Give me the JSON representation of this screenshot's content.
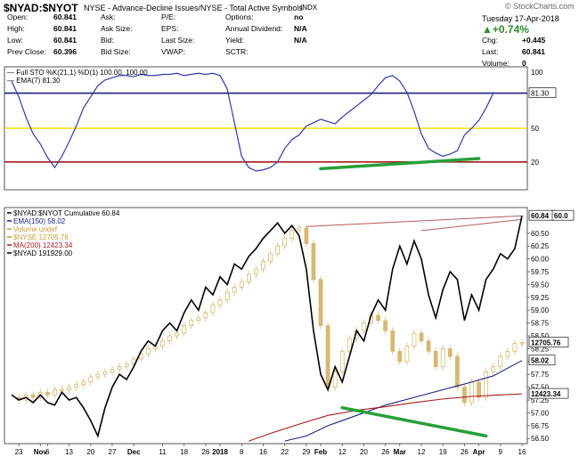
{
  "header": {
    "symbol": "$NYAD:$NYOT",
    "description": "NYSE - Advance-Decline Issues/NYSE - Total Active Symbols",
    "index_tag": "INDX",
    "watermark": "© StockCharts.com",
    "date": "Tuesday  17-Apr-2018",
    "change_pct": "+0.74%",
    "quote": [
      {
        "label": "Open:",
        "value": "60.841"
      },
      {
        "label": "High:",
        "value": "60.841"
      },
      {
        "label": "Low:",
        "value": "60.841"
      },
      {
        "label": "Prev Close:",
        "value": "60.396"
      },
      {
        "label": "Ask:",
        "value": ""
      },
      {
        "label": "Ask Size:",
        "value": ""
      },
      {
        "label": "Bid:",
        "value": ""
      },
      {
        "label": "Bid Size:",
        "value": ""
      },
      {
        "label": "P/E:",
        "value": ""
      },
      {
        "label": "EPS:",
        "value": ""
      },
      {
        "label": "Last Size:",
        "value": ""
      },
      {
        "label": "VWAP:",
        "value": ""
      },
      {
        "label": "Options:",
        "value": "no"
      },
      {
        "label": "Annual Dividend:",
        "value": "N/A"
      },
      {
        "label": "Yield:",
        "value": "N/A"
      },
      {
        "label": "SCTR:",
        "value": ""
      }
    ],
    "right": [
      {
        "label": "Chg:",
        "value": "+0.445"
      },
      {
        "label": "Last:",
        "value": "60.841"
      },
      {
        "label": "Volume:",
        "value": "0"
      }
    ]
  },
  "chart_data": [
    {
      "type": "line",
      "panel": "stochastic",
      "legend": [
        "Full STO %K(21,1) %D(1) 100.00, 100.00",
        "EMA(7) 81.30"
      ],
      "ylim": [
        0,
        100
      ],
      "y_ticks": [
        20,
        50,
        81.3,
        100
      ],
      "reference_lines": [
        {
          "value": 81.3,
          "color": "#1a237e"
        },
        {
          "value": 50,
          "color": "#f2e100"
        },
        {
          "value": 20,
          "color": "#a61b1b"
        }
      ],
      "series": [
        {
          "name": "EMA(7)",
          "color": "#2f3aa8",
          "values": [
            92,
            78,
            60,
            45,
            36,
            24,
            15,
            25,
            38,
            52,
            68,
            78,
            88,
            93,
            95,
            97,
            97,
            96,
            98,
            97,
            97,
            98,
            98,
            99,
            97,
            98,
            99,
            98,
            99,
            97,
            85,
            55,
            25,
            15,
            12,
            13,
            15,
            20,
            32,
            40,
            44,
            52,
            55,
            58,
            56,
            54,
            60,
            65,
            70,
            75,
            80,
            88,
            95,
            97,
            92,
            82,
            65,
            45,
            32,
            28,
            25,
            27,
            30,
            44,
            50,
            57,
            68,
            81.3
          ]
        }
      ],
      "annotation": {
        "type": "trendline",
        "color": "#27a03a",
        "from": [
          43,
          14
        ],
        "to": [
          65,
          23
        ]
      }
    },
    {
      "type": "line",
      "panel": "main",
      "legend": [
        {
          "text": "$NYAD:$NYOT Cumulative 60.84",
          "color": "#000000"
        },
        {
          "text": "EMA(150) 58.02",
          "color": "#1a237e"
        },
        {
          "text": "Volume undef",
          "color": "#c89a3a"
        },
        {
          "text": "$NYSE 12705.76",
          "color": "#c89a3a"
        },
        {
          "text": "MA(200) 12423.34",
          "color": "#a61b1b"
        },
        {
          "text": "$NYAD 191929.00",
          "color": "#000000"
        }
      ],
      "ylim": [
        56.4,
        61.0
      ],
      "y_ticks": [
        56.5,
        56.75,
        57.0,
        57.25,
        57.5,
        57.75,
        58.0,
        58.25,
        58.5,
        58.75,
        59.0,
        59.25,
        59.5,
        59.75,
        60.0,
        60.25,
        60.5
      ],
      "y_tick_labels": [
        "56.50",
        "56.75",
        "57.00",
        "57.25",
        "57.50",
        "57.75",
        "58.00",
        "58.25",
        "58.50",
        "58.75",
        "59.00",
        "59.25",
        "59.50",
        "59.75",
        "60.00",
        "60.25",
        "60.50"
      ],
      "price_tags": [
        {
          "label": "60.84",
          "value": 60.84
        },
        {
          "label": "60.0",
          "value": 60.84
        },
        {
          "label": "12705.76",
          "value": 58.37
        },
        {
          "label": "58.02",
          "value": 58.02
        },
        {
          "label": "12423.34",
          "value": 57.37
        }
      ],
      "x_ticks": [
        {
          "label": "23",
          "i": 1
        },
        {
          "label": "Nov",
          "i": 4,
          "bold": true
        },
        {
          "label": "6",
          "i": 5
        },
        {
          "label": "13",
          "i": 8
        },
        {
          "label": "20",
          "i": 11
        },
        {
          "label": "27",
          "i": 14
        },
        {
          "label": "Dec",
          "i": 17,
          "bold": true
        },
        {
          "label": "11",
          "i": 21
        },
        {
          "label": "18",
          "i": 24
        },
        {
          "label": "26",
          "i": 27
        },
        {
          "label": "2018",
          "i": 29,
          "bold": true
        },
        {
          "label": "8",
          "i": 32
        },
        {
          "label": "16",
          "i": 35
        },
        {
          "label": "22",
          "i": 38
        },
        {
          "label": "29",
          "i": 41
        },
        {
          "label": "Feb",
          "i": 43,
          "bold": true
        },
        {
          "label": "12",
          "i": 46
        },
        {
          "label": "20",
          "i": 49
        },
        {
          "label": "26",
          "i": 52
        },
        {
          "label": "Mar",
          "i": 54,
          "bold": true
        },
        {
          "label": "12",
          "i": 57
        },
        {
          "label": "19",
          "i": 60
        },
        {
          "label": "26",
          "i": 63
        },
        {
          "label": "Apr",
          "i": 65,
          "bold": true
        },
        {
          "label": "9",
          "i": 68
        },
        {
          "label": "16",
          "i": 71
        }
      ],
      "series": [
        {
          "name": "$NYAD:$NYOT Cumulative",
          "color": "#000000",
          "values": [
            57.35,
            57.25,
            57.3,
            57.2,
            57.35,
            57.2,
            57.15,
            57.4,
            57.25,
            57.3,
            57.1,
            56.85,
            56.55,
            57.1,
            57.5,
            57.75,
            57.65,
            57.9,
            58.2,
            58.4,
            58.3,
            58.6,
            58.75,
            58.6,
            58.95,
            59.2,
            59.0,
            59.45,
            59.3,
            59.65,
            59.5,
            59.9,
            59.8,
            60.05,
            60.2,
            60.4,
            60.55,
            60.7,
            60.5,
            60.65,
            60.45,
            59.8,
            58.6,
            57.75,
            57.45,
            57.9,
            57.6,
            58.1,
            58.6,
            58.4,
            58.9,
            59.2,
            59.0,
            59.8,
            60.25,
            59.9,
            60.35,
            60.0,
            59.3,
            58.85,
            59.4,
            59.75,
            59.6,
            58.8,
            59.3,
            59.0,
            59.6,
            59.8,
            60.1,
            60.0,
            60.2,
            60.84
          ]
        },
        {
          "name": "EMA(150)",
          "color": "#1a237e",
          "points": [
            [
              38,
              56.45
            ],
            [
              41,
              56.55
            ],
            [
              44,
              56.75
            ],
            [
              48,
              56.95
            ],
            [
              52,
              57.15
            ],
            [
              56,
              57.3
            ],
            [
              60,
              57.45
            ],
            [
              64,
              57.6
            ],
            [
              67,
              57.72
            ],
            [
              71,
              58.02
            ]
          ]
        },
        {
          "name": "MA(200)",
          "color": "#a61b1b",
          "points": [
            [
              33,
              56.45
            ],
            [
              36,
              56.6
            ],
            [
              40,
              56.78
            ],
            [
              44,
              56.95
            ],
            [
              48,
              57.05
            ],
            [
              52,
              57.12
            ],
            [
              56,
              57.2
            ],
            [
              60,
              57.27
            ],
            [
              64,
              57.32
            ],
            [
              68,
              57.35
            ],
            [
              71,
              57.37
            ]
          ]
        },
        {
          "name": "$NYSE",
          "color": "#d8b774",
          "type": "candles",
          "values": [
            57.3,
            57.25,
            57.35,
            57.3,
            57.4,
            57.35,
            57.45,
            57.45,
            57.5,
            57.55,
            57.6,
            57.7,
            57.75,
            57.8,
            57.85,
            57.9,
            57.95,
            58.05,
            58.15,
            58.25,
            58.3,
            58.4,
            58.5,
            58.55,
            58.7,
            58.8,
            58.85,
            58.95,
            59.1,
            59.2,
            59.35,
            59.45,
            59.55,
            59.7,
            59.8,
            59.95,
            60.1,
            60.25,
            60.4,
            60.55,
            60.6,
            60.3,
            59.6,
            58.7,
            57.5,
            57.8,
            58.2,
            58.45,
            58.6,
            58.75,
            58.9,
            58.8,
            58.6,
            58.2,
            58.0,
            58.3,
            58.55,
            58.4,
            58.2,
            57.9,
            58.25,
            58.1,
            57.5,
            57.2,
            57.6,
            57.3,
            57.8,
            57.9,
            58.1,
            58.2,
            58.35,
            58.37
          ]
        }
      ],
      "annotations": [
        {
          "type": "trendline",
          "color": "#b35b5b",
          "from": [
            41,
            60.63
          ],
          "to": [
            71,
            60.84
          ]
        },
        {
          "type": "trendline",
          "color": "#b35b5b",
          "from": [
            57,
            60.55
          ],
          "to": [
            71,
            60.77
          ]
        },
        {
          "type": "trendline",
          "color": "#27a03a",
          "from": [
            46,
            57.1
          ],
          "to": [
            66,
            56.55
          ]
        }
      ]
    }
  ]
}
